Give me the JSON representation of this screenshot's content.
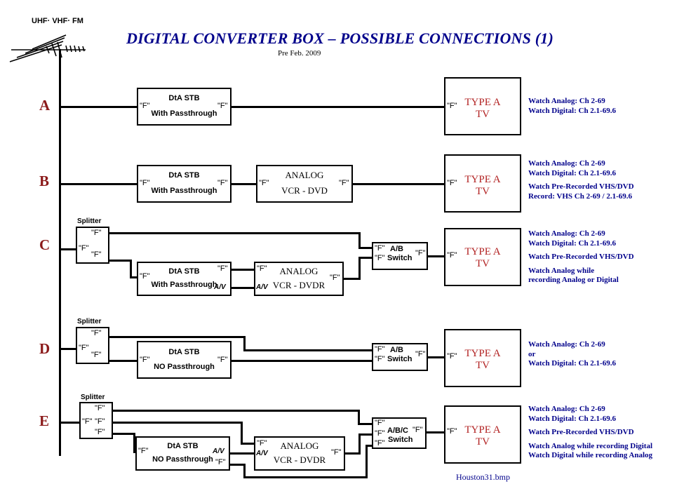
{
  "header": {
    "title": "DIGITAL CONVERTER BOX – POSSIBLE CONNECTIONS (1)",
    "subtitle": "Pre Feb. 2009",
    "title_color": "#00008B"
  },
  "antenna": {
    "label": "UHF· VHF· FM",
    "icon": "tv-antenna-icon"
  },
  "caption": "Houston31.bmp",
  "labels": {
    "f_connector": "\"F\"",
    "av_connector": "A/V",
    "splitter": "Splitter"
  },
  "rows": [
    {
      "letter": "A",
      "boxes": {
        "stb": {
          "line1": "DtA STB",
          "line2": "With Passthrough"
        },
        "tv": {
          "line1": "TYPE A",
          "line2": "TV"
        }
      },
      "annotations": [
        "Watch Analog: Ch 2-69",
        "Watch Digital: Ch 2.1-69.6"
      ]
    },
    {
      "letter": "B",
      "boxes": {
        "stb": {
          "line1": "DtA STB",
          "line2": "With Passthrough"
        },
        "vcr": {
          "line1": "ANALOG",
          "line2": "VCR - DVD"
        },
        "tv": {
          "line1": "TYPE A",
          "line2": "TV"
        }
      },
      "annotations": [
        "Watch Analog: Ch 2-69",
        "Watch Digital: Ch 2.1-69.6",
        "",
        "Watch Pre-Recorded VHS/DVD",
        "Record: VHS Ch 2-69 / 2.1-69.6"
      ]
    },
    {
      "letter": "C",
      "boxes": {
        "stb": {
          "line1": "DtA STB",
          "line2": "With Passthrough"
        },
        "vcr": {
          "line1": "ANALOG",
          "line2": "VCR - DVDR"
        },
        "switch": {
          "line1": "A/B",
          "line2": "Switch"
        },
        "tv": {
          "line1": "TYPE A",
          "line2": "TV"
        }
      },
      "annotations": [
        "Watch Analog: Ch 2-69",
        "Watch Digital: Ch 2.1-69.6",
        "",
        "Watch Pre-Recorded VHS/DVD",
        "",
        "Watch Analog while",
        "recording Analog or Digital"
      ]
    },
    {
      "letter": "D",
      "boxes": {
        "stb": {
          "line1": "DtA STB",
          "line2": "NO Passthrough"
        },
        "switch": {
          "line1": "A/B",
          "line2": "Switch"
        },
        "tv": {
          "line1": "TYPE A",
          "line2": "TV"
        }
      },
      "annotations": [
        "Watch Analog: Ch 2-69",
        " or",
        "Watch Digital: Ch 2.1-69.6"
      ]
    },
    {
      "letter": "E",
      "boxes": {
        "stb": {
          "line1": "DtA STB",
          "line2": "NO Passthrough"
        },
        "vcr": {
          "line1": "ANALOG",
          "line2": "VCR - DVDR"
        },
        "switch": {
          "line1": "A/B/C",
          "line2": "Switch"
        },
        "tv": {
          "line1": "TYPE A",
          "line2": "TV"
        }
      },
      "annotations": [
        "Watch Analog: Ch 2-69",
        "Watch Digital: Ch 2.1-69.6",
        "",
        "Watch Pre-Recorded VHS/DVD",
        "",
        "Watch Analog while recording Digital",
        "Watch Digital while recording Analog"
      ]
    }
  ]
}
